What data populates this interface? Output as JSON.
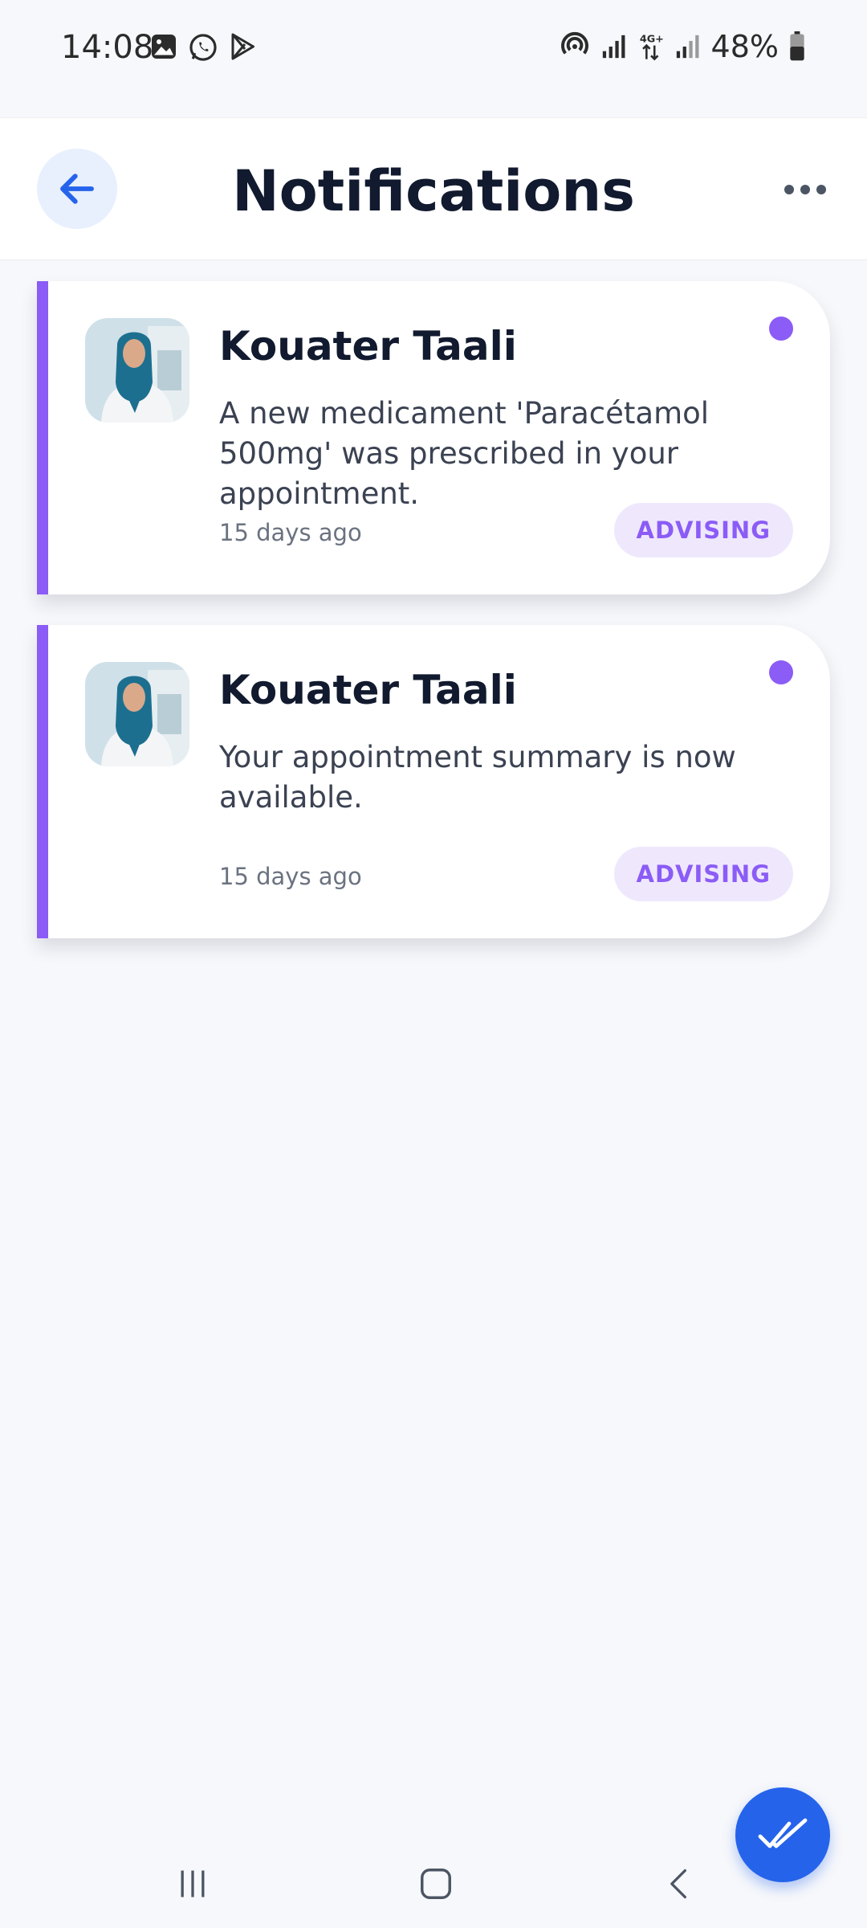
{
  "status_bar": {
    "time": "14:08",
    "battery": "48%",
    "left_icons": [
      "gallery-icon",
      "whatsapp-icon",
      "play-store-icon"
    ],
    "right_icons": [
      "hotspot-icon",
      "signal-icon",
      "4g-data-icon",
      "signal-icon",
      "battery-icon"
    ]
  },
  "header": {
    "title": "Notifications",
    "back_icon": "arrow-left-icon",
    "menu_icon": "more-horizontal-icon"
  },
  "notifications": [
    {
      "sender": "Kouater Taali",
      "message": "A new medicament 'Paracétamol 500mg' was prescribed in your appointment.",
      "time": "15 days ago",
      "category": "ADVISING",
      "unread": true
    },
    {
      "sender": "Kouater Taali",
      "message": "Your appointment summary is now available.",
      "time": "15 days ago",
      "category": "ADVISING",
      "unread": true
    }
  ],
  "fab": {
    "icon": "double-check-icon"
  },
  "nav_bar": [
    "recents-icon",
    "home-icon",
    "back-icon"
  ],
  "colors": {
    "accent": "#8b5cf6",
    "primary": "#2563eb",
    "badge_bg": "#efe8fd",
    "background": "#f7f8fb"
  }
}
